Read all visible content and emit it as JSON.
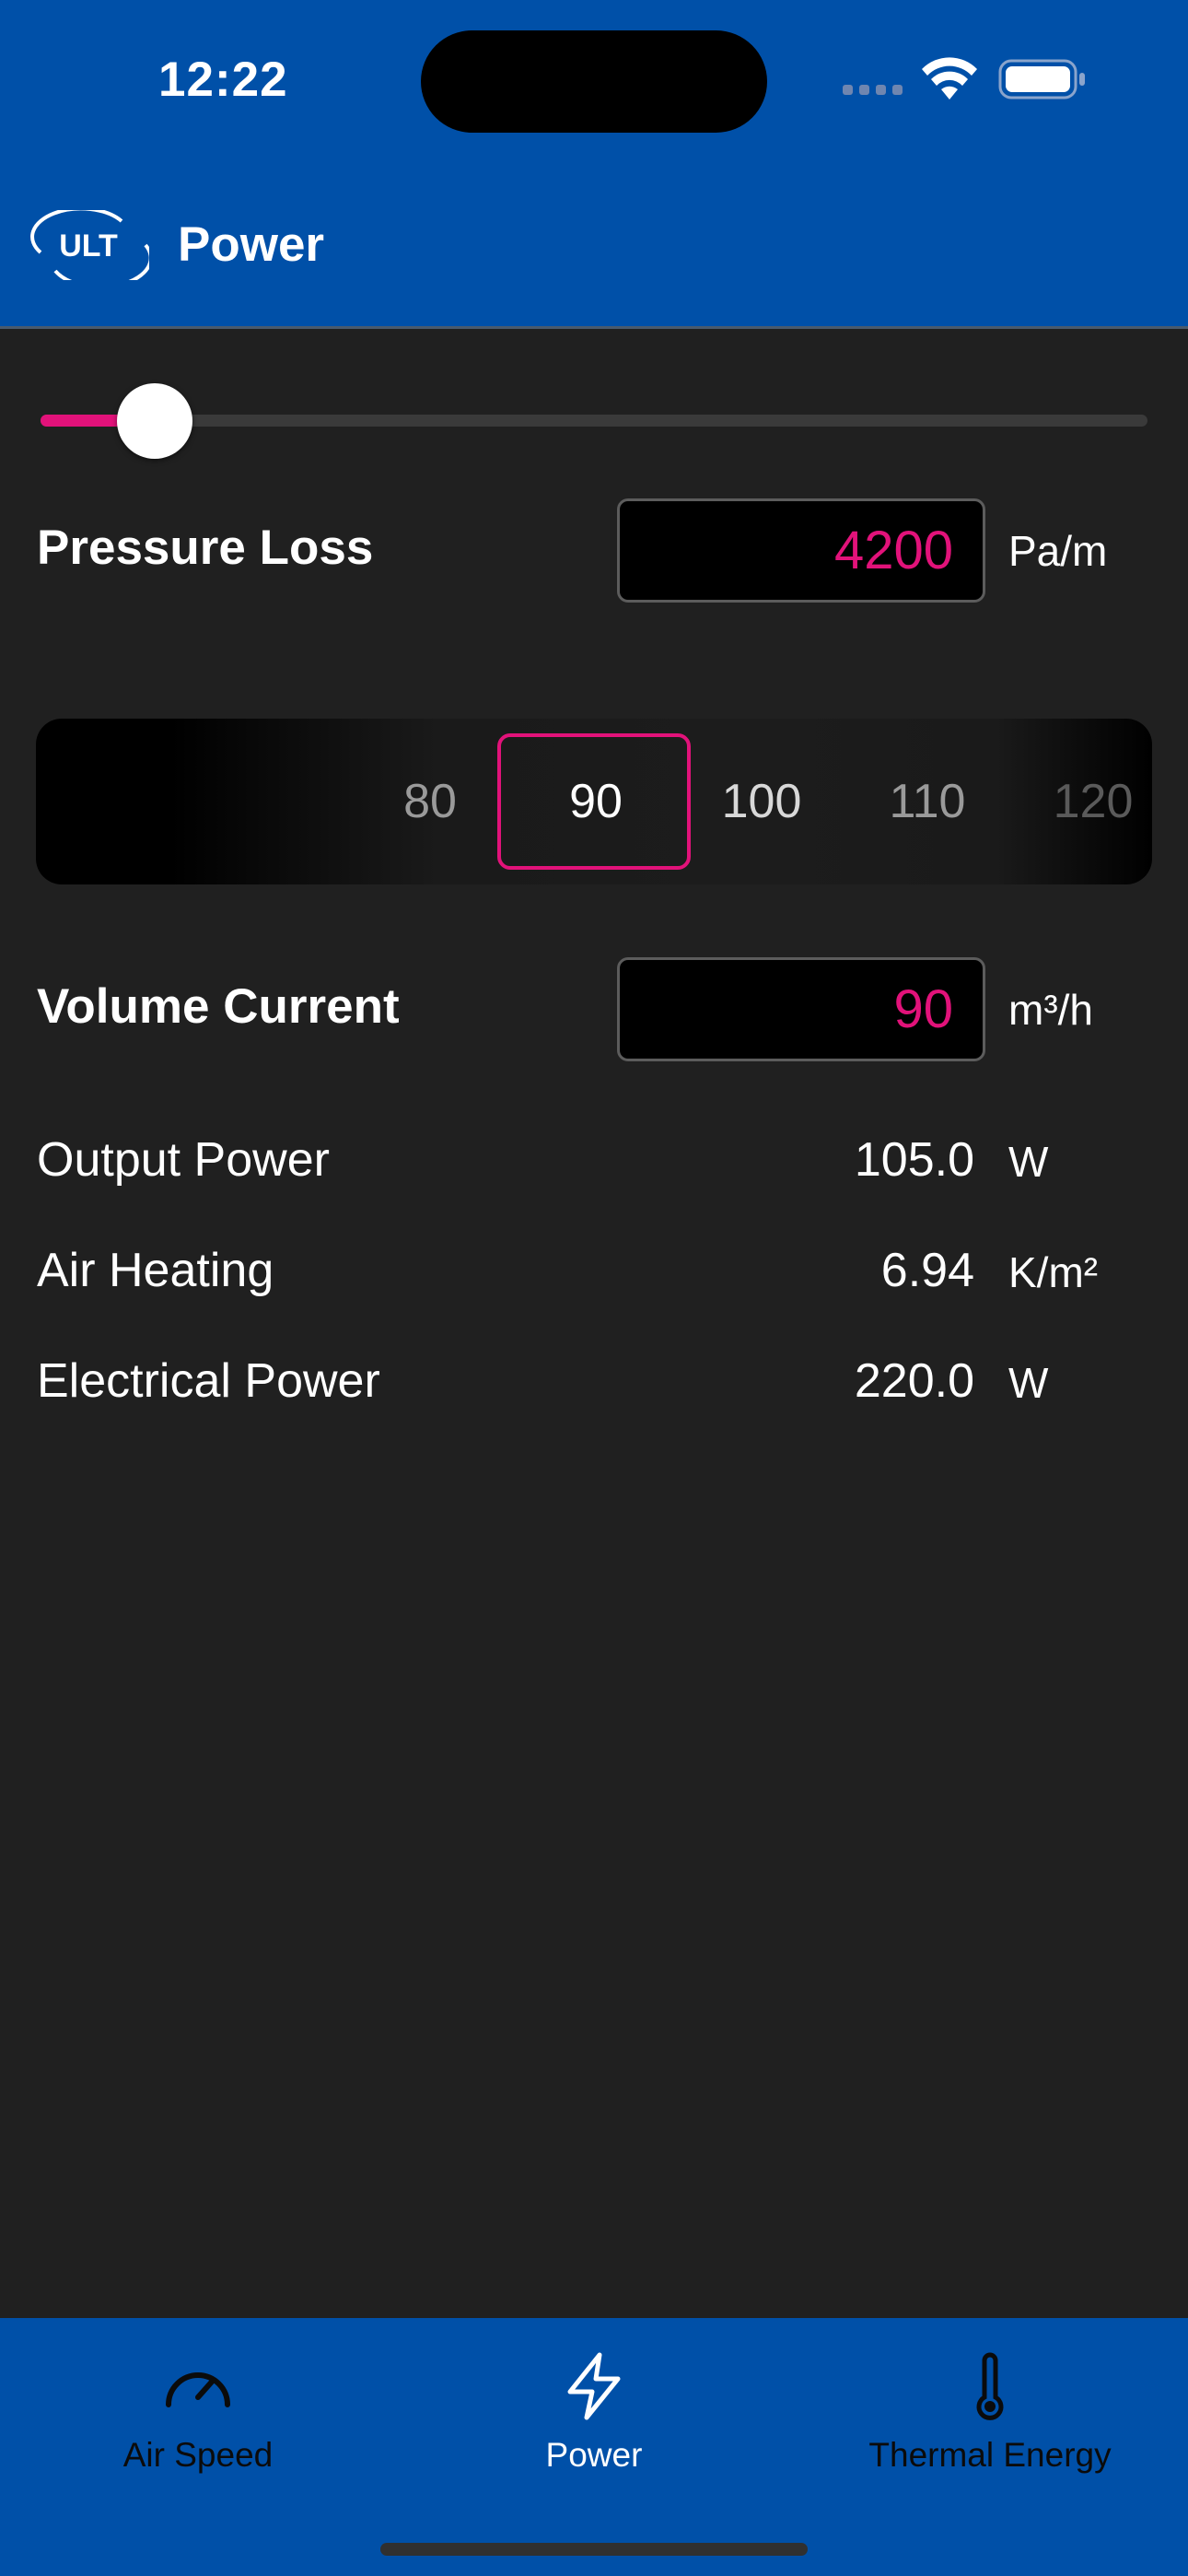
{
  "status_bar": {
    "time": "12:22",
    "icons": [
      "cellular-signal-icon",
      "wifi-icon",
      "battery-icon"
    ]
  },
  "header": {
    "logo_text": "ULT",
    "title": "Power"
  },
  "pressure_slider": {
    "level_fraction": 0.098
  },
  "pressure_loss": {
    "label": "Pressure Loss",
    "value": "4200",
    "unit": "Pa/m"
  },
  "volume_picker": {
    "options": [
      "80",
      "90",
      "100",
      "110",
      "120"
    ],
    "selected": "90"
  },
  "volume_current": {
    "label": "Volume Current",
    "value": "90",
    "unit": "m³/h"
  },
  "results": [
    {
      "label": "Output Power",
      "value": "105.0",
      "unit": "W"
    },
    {
      "label": "Air Heating",
      "value": "6.94",
      "unit": "K/m²"
    },
    {
      "label": "Electrical Power",
      "value": "220.0",
      "unit": "W"
    }
  ],
  "tabs": [
    {
      "label": "Air Speed",
      "icon": "speedometer-icon",
      "active": false
    },
    {
      "label": "Power",
      "icon": "lightning-bolt-icon",
      "active": true
    },
    {
      "label": "Thermal Energy",
      "icon": "thermometer-icon",
      "active": false
    }
  ],
  "colors": {
    "brand_blue": "#0050A8",
    "accent_pink": "#E2127A",
    "background": "#202020"
  }
}
